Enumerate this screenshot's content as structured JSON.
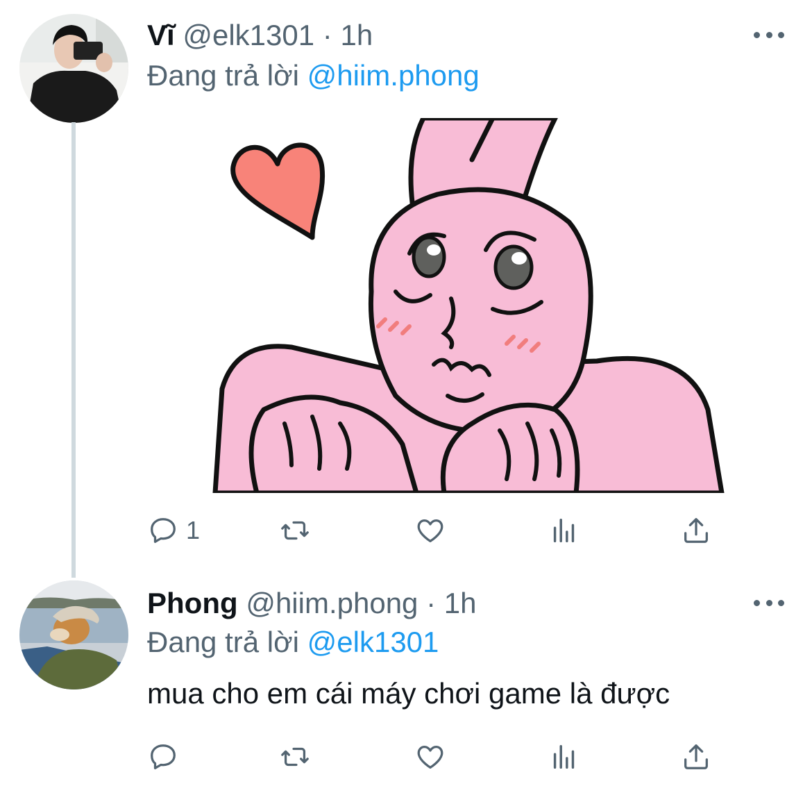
{
  "tweets": [
    {
      "name": "Vĩ",
      "handle": "@elk1301",
      "dot": "·",
      "time": "1h",
      "reply_prefix": "Đang trả lời",
      "reply_to": "@hiim.phong",
      "media": "pink-bunny-sticker",
      "reply_count": "1"
    },
    {
      "name": "Phong",
      "handle": "@hiim.phong",
      "dot": "·",
      "time": "1h",
      "reply_prefix": "Đang trả lời",
      "reply_to": "@elk1301",
      "text": "mua cho em cái máy chơi game là được",
      "reply_count": ""
    }
  ],
  "icons": {
    "reply": "speech-bubble-icon",
    "retweet": "retweet-arrows-icon",
    "like": "heart-icon",
    "analytics": "bar-chart-icon",
    "share": "share-upload-icon",
    "more": "more-dots-icon"
  },
  "colors": {
    "accent": "#1d9bf0",
    "secondary_text": "#536471",
    "bunny_pink": "#f8bcd6",
    "heart": "#f88379"
  }
}
